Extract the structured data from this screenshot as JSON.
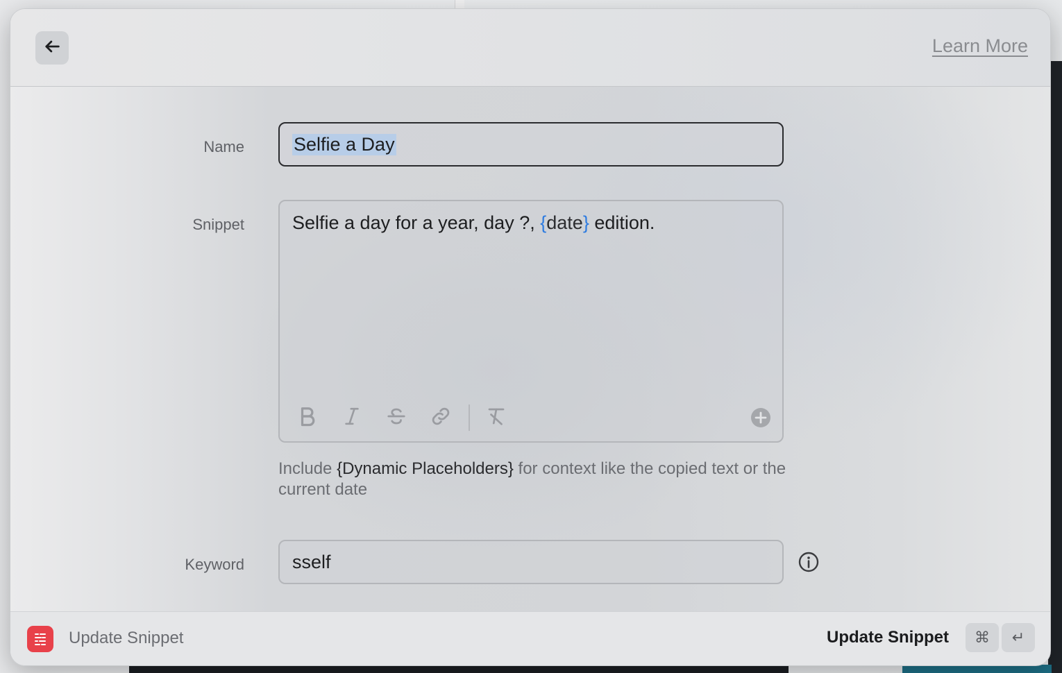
{
  "header": {
    "back_icon": "arrow-left-icon",
    "learn_more": "Learn More"
  },
  "form": {
    "name_label": "Name",
    "name_value": "Selfie a Day",
    "snippet_label": "Snippet",
    "snippet_text_before": "Selfie a day for a year, day ?, ",
    "snippet_placeholder_open": "{",
    "snippet_placeholder_name": "date",
    "snippet_placeholder_close": "}",
    "snippet_text_after": " edition.",
    "toolbar": [
      "bold-icon",
      "italic-icon",
      "strikethrough-icon",
      "link-icon",
      "clear-format-icon",
      "add-icon"
    ],
    "hint_before": "Include ",
    "hint_strong": "{Dynamic Placeholders}",
    "hint_after": " for context like the copied text or the current date",
    "keyword_label": "Keyword",
    "keyword_value": "sself",
    "info_icon": "info-icon"
  },
  "footer": {
    "app_icon": "snippet-app-icon",
    "title": "Update Snippet",
    "action_label": "Update Snippet",
    "shortcut_cmd": "⌘",
    "shortcut_return": "↵"
  },
  "colors": {
    "placeholder_accent": "#2d7be0",
    "footer_icon": "#e8414a",
    "selection": "#b7cde8"
  }
}
